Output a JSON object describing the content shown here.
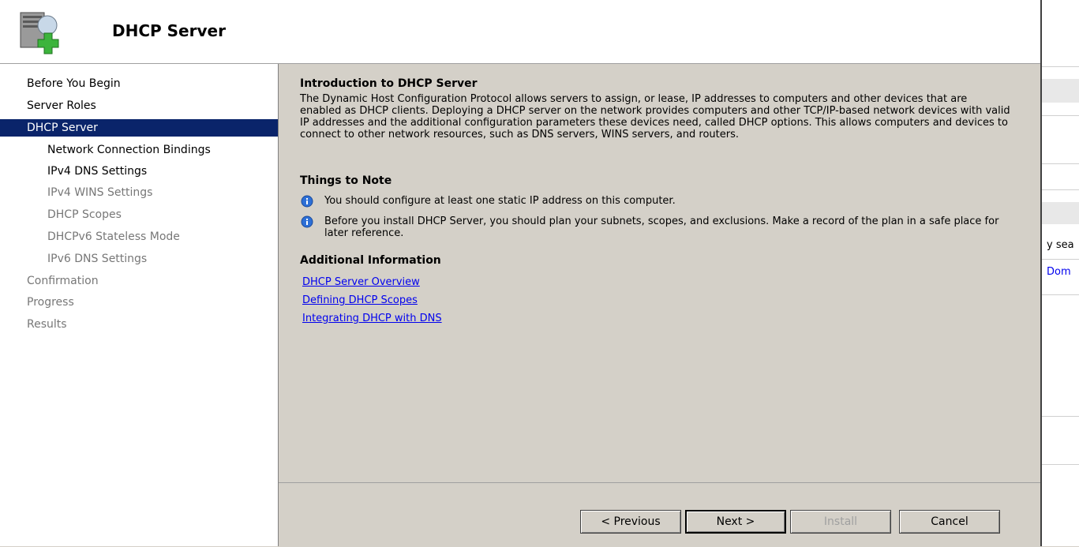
{
  "header": {
    "title": "DHCP Server",
    "icon": "server-add-icon"
  },
  "nav": {
    "items": [
      {
        "label": "Before You Begin",
        "level": "top",
        "state": "normal"
      },
      {
        "label": "Server Roles",
        "level": "top",
        "state": "normal"
      },
      {
        "label": "DHCP Server",
        "level": "top",
        "state": "active"
      },
      {
        "label": "Network Connection Bindings",
        "level": "sub",
        "state": "normal"
      },
      {
        "label": "IPv4 DNS Settings",
        "level": "sub",
        "state": "normal"
      },
      {
        "label": "IPv4 WINS Settings",
        "level": "sub",
        "state": "dim"
      },
      {
        "label": "DHCP Scopes",
        "level": "sub",
        "state": "dim"
      },
      {
        "label": "DHCPv6 Stateless Mode",
        "level": "sub",
        "state": "dim"
      },
      {
        "label": "IPv6 DNS Settings",
        "level": "sub",
        "state": "dim"
      },
      {
        "label": "Confirmation",
        "level": "top",
        "state": "dim"
      },
      {
        "label": "Progress",
        "level": "top",
        "state": "dim"
      },
      {
        "label": "Results",
        "level": "top",
        "state": "dim"
      }
    ]
  },
  "content": {
    "intro_title": "Introduction to DHCP Server",
    "intro_text": "The Dynamic Host Configuration Protocol allows servers to assign, or lease, IP addresses to computers and other devices that are enabled as DHCP clients. Deploying a DHCP server on the network provides computers and other TCP/IP-based network devices with valid IP addresses and the additional configuration parameters these devices need, called DHCP options. This allows computers and devices to connect to other network resources, such as DNS servers, WINS servers, and routers.",
    "notes_title": "Things to Note",
    "notes": [
      "You should configure at least one static IP address on this computer.",
      "Before you install DHCP Server, you should plan your subnets, scopes, and exclusions. Make a record of the plan in a safe place for later reference."
    ],
    "additional_title": "Additional Information",
    "links": [
      "DHCP Server Overview",
      "Defining DHCP Scopes",
      "Integrating DHCP with DNS"
    ]
  },
  "buttons": {
    "previous": "< Previous",
    "next": "Next >",
    "install": "Install",
    "cancel": "Cancel"
  },
  "right_panel": {
    "text1": "y sea",
    "text2": "Dom"
  },
  "colors": {
    "active_nav_bg": "#0a246a",
    "link": "#0000ee",
    "dialog_bg": "#d4d0c8"
  }
}
